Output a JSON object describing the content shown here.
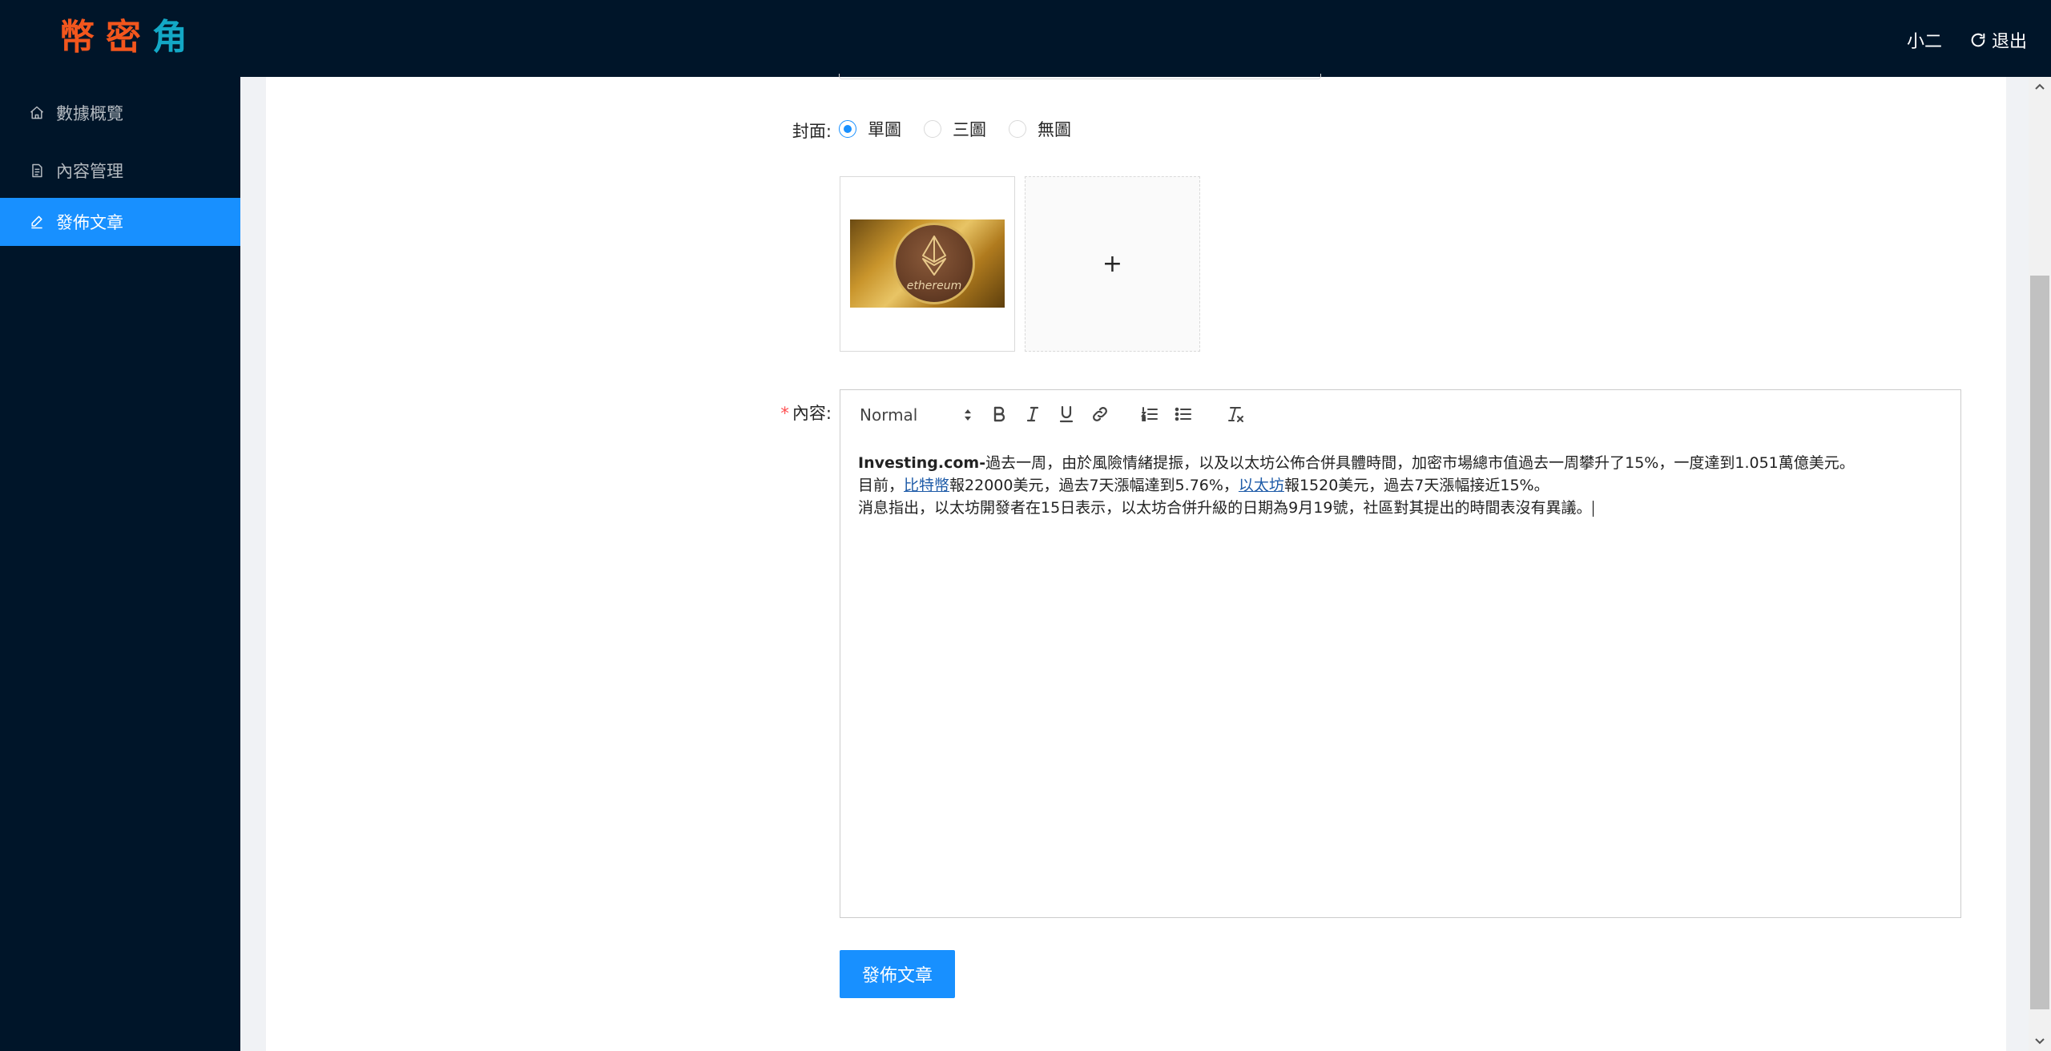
{
  "app": {
    "logo": [
      "幣",
      "密",
      "角"
    ],
    "user_name": "小二",
    "logout_label": "退出"
  },
  "sidebar": {
    "items": [
      {
        "label": "數據概覽",
        "icon": "home-icon"
      },
      {
        "label": "內容管理",
        "icon": "document-icon"
      },
      {
        "label": "發佈文章",
        "icon": "edit-icon",
        "active": true
      }
    ]
  },
  "form": {
    "cover": {
      "label": "封面:",
      "options": [
        "單圖",
        "三圖",
        "無圖"
      ],
      "selected": "單圖"
    },
    "content": {
      "label": "內容:",
      "required": true
    },
    "submit_label": "發佈文章"
  },
  "editor": {
    "header_select": "Normal",
    "toolbar_icons": [
      "bold-icon",
      "italic-icon",
      "underline-icon",
      "link-icon",
      "ordered-list-icon",
      "bullet-list-icon",
      "clear-format-icon"
    ],
    "paragraphs": {
      "p1_bold": "Investing.com-",
      "p1_rest": "過去一周，由於風險情緒提振，以及以太坊公佈合併具體時間，加密市場總市值過去一周攀升了15%，一度達到1.051萬億美元。",
      "p2_a": "目前，",
      "p2_link1": "比特幣",
      "p2_b": "報22000美元，過去7天漲幅達到5.76%，",
      "p2_link2": "以太坊",
      "p2_c": "報1520美元，過去7天漲幅接近15%。",
      "p3": "消息指出，以太坊開發者在15日表示，以太坊合併升級的日期為9月19號，社區對其提出的時間表沒有異議。"
    }
  },
  "cover_image": {
    "text": "ethereum"
  },
  "colors": {
    "header_bg": "#001529",
    "primary": "#1890ff",
    "logo_orange": "#f2561d",
    "logo_teal": "#13a8c6",
    "required": "#ff4d4f"
  }
}
